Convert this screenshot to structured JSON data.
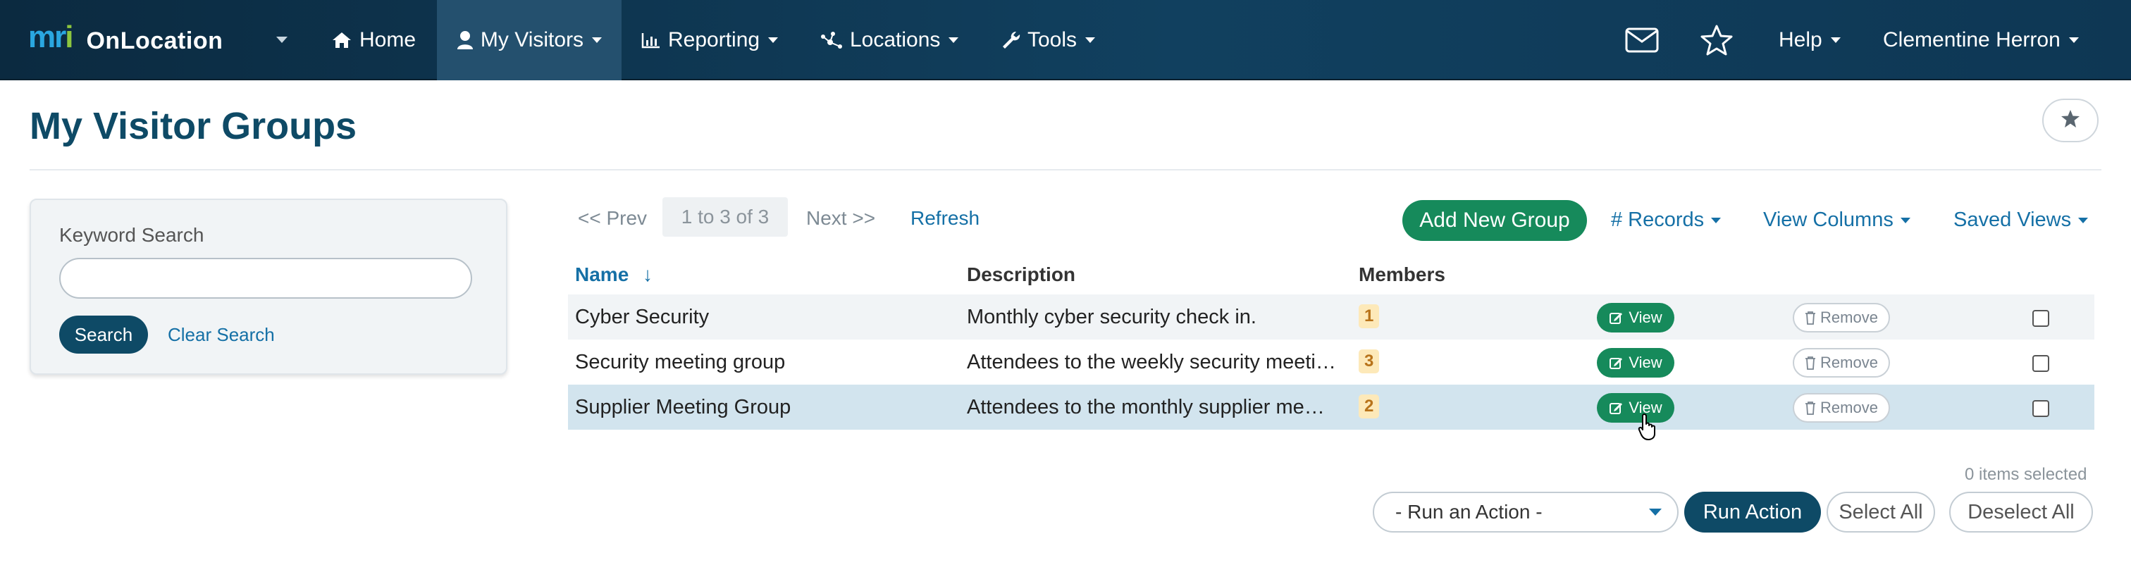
{
  "app": {
    "brand_logo": "mri",
    "brand_name": "OnLocation"
  },
  "nav": {
    "home": "Home",
    "my_visitors": "My Visitors",
    "reporting": "Reporting",
    "locations": "Locations",
    "tools": "Tools",
    "help": "Help",
    "user": "Clementine Herron",
    "icons": [
      "home-icon",
      "user-icon",
      "chart-icon",
      "network-icon",
      "wrench-icon",
      "mail-icon",
      "star-icon"
    ]
  },
  "page": {
    "title": "My Visitor Groups"
  },
  "search": {
    "label": "Keyword Search",
    "value": "",
    "button": "Search",
    "clear": "Clear Search"
  },
  "pager": {
    "prev": "<< Prev",
    "range": "1 to 3 of 3",
    "next": "Next >>",
    "refresh": "Refresh"
  },
  "toolbar": {
    "add_group": "Add New Group",
    "records": "# Records",
    "view_columns": "View Columns",
    "saved_views": "Saved Views"
  },
  "table": {
    "headers": {
      "name": "Name",
      "sort_arrow": "↓",
      "description": "Description",
      "members": "Members"
    },
    "view_label": "View",
    "remove_label": "Remove",
    "rows": [
      {
        "name": "Cyber Security",
        "description": "Monthly cyber security check in.",
        "members": "1",
        "checked": false
      },
      {
        "name": "Security meeting group",
        "description": "Attendees to the weekly security meeti…",
        "members": "3",
        "checked": false
      },
      {
        "name": "Supplier Meeting Group",
        "description": "Attendees to the monthly supplier me…",
        "members": "2",
        "checked": false
      }
    ]
  },
  "actions": {
    "items_selected": "0 items selected",
    "run_an_action": "- Run an Action -",
    "run_action": "Run Action",
    "select_all": "Select All",
    "deselect_all": "Deselect All"
  },
  "colors": {
    "nav_bg": "#0e3754",
    "nav_active": "#24506e",
    "title": "#0e4a66",
    "link": "#1570a6",
    "green": "#168a5b",
    "badge_bg": "#fde9b9",
    "badge_fg": "#b8731a",
    "row_hover": "#d2e4ee"
  }
}
